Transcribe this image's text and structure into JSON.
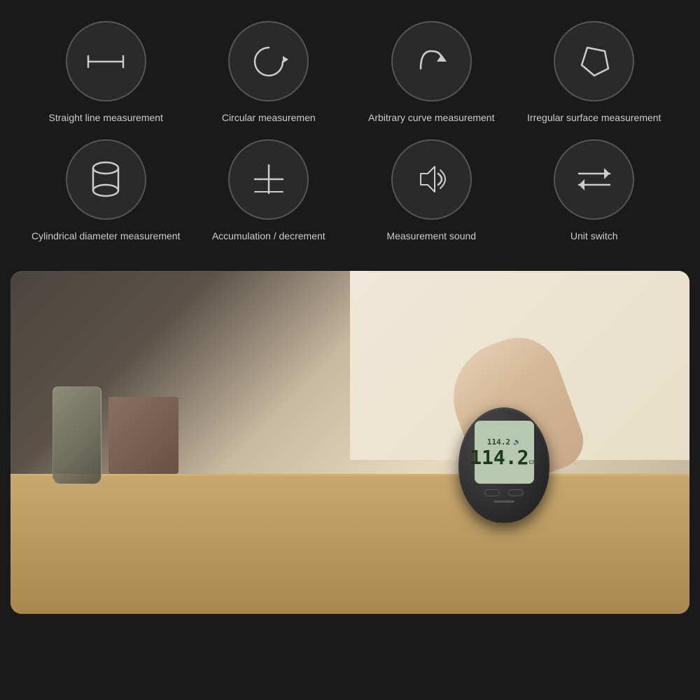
{
  "background_color": "#1a1a1a",
  "features": [
    {
      "id": "straight-line",
      "label": "Straight line\nmeasurement",
      "icon": "straight-line-icon"
    },
    {
      "id": "circular",
      "label": "Circular\nmeasuremen",
      "icon": "circular-icon"
    },
    {
      "id": "arbitrary-curve",
      "label": "Arbitrary curve\nmeasurement",
      "icon": "curve-icon"
    },
    {
      "id": "irregular-surface",
      "label": "Irregular surface\nmeasurement",
      "icon": "irregular-icon"
    },
    {
      "id": "cylindrical",
      "label": "Cylindrical\ndiameter\nmeasurement",
      "icon": "cylinder-icon"
    },
    {
      "id": "accumulation",
      "label": "Accumulation /\ndecrement",
      "icon": "plus-minus-icon"
    },
    {
      "id": "measurement-sound",
      "label": "Measurement\nsound",
      "icon": "sound-icon"
    },
    {
      "id": "unit-switch",
      "label": "Unit switch",
      "icon": "unit-switch-icon"
    }
  ],
  "device": {
    "display_main": "114.2",
    "display_secondary": "114.2",
    "unit": "cm"
  }
}
